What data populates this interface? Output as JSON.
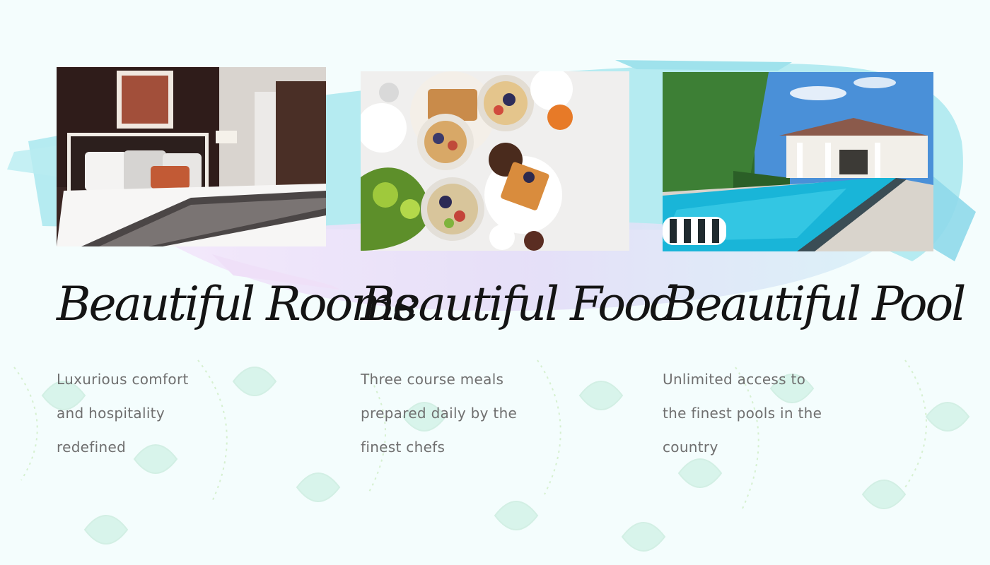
{
  "colors": {
    "background": "#f4fdfd",
    "brush_cyan": "#8fe0ea",
    "brush_lavender": "#e6d6f7",
    "leaf_mint": "#d6f4ea",
    "title": "#141414",
    "description": "#6f6f6f"
  },
  "cards": [
    {
      "title": "Beautiful Rooms",
      "description_lines": [
        "Luxurious comfort",
        "and hospitality",
        "redefined"
      ],
      "image_label": "hotel-bedroom-photo"
    },
    {
      "title": "Beautiful Food",
      "description_lines": [
        "Three course meals",
        "prepared daily by the",
        "finest chefs"
      ],
      "image_label": "breakfast-spread-photo"
    },
    {
      "title": "Beautiful Pool",
      "description_lines": [
        "Unlimited access to",
        "the finest pools in the",
        "country"
      ],
      "image_label": "resort-pool-photo"
    }
  ]
}
